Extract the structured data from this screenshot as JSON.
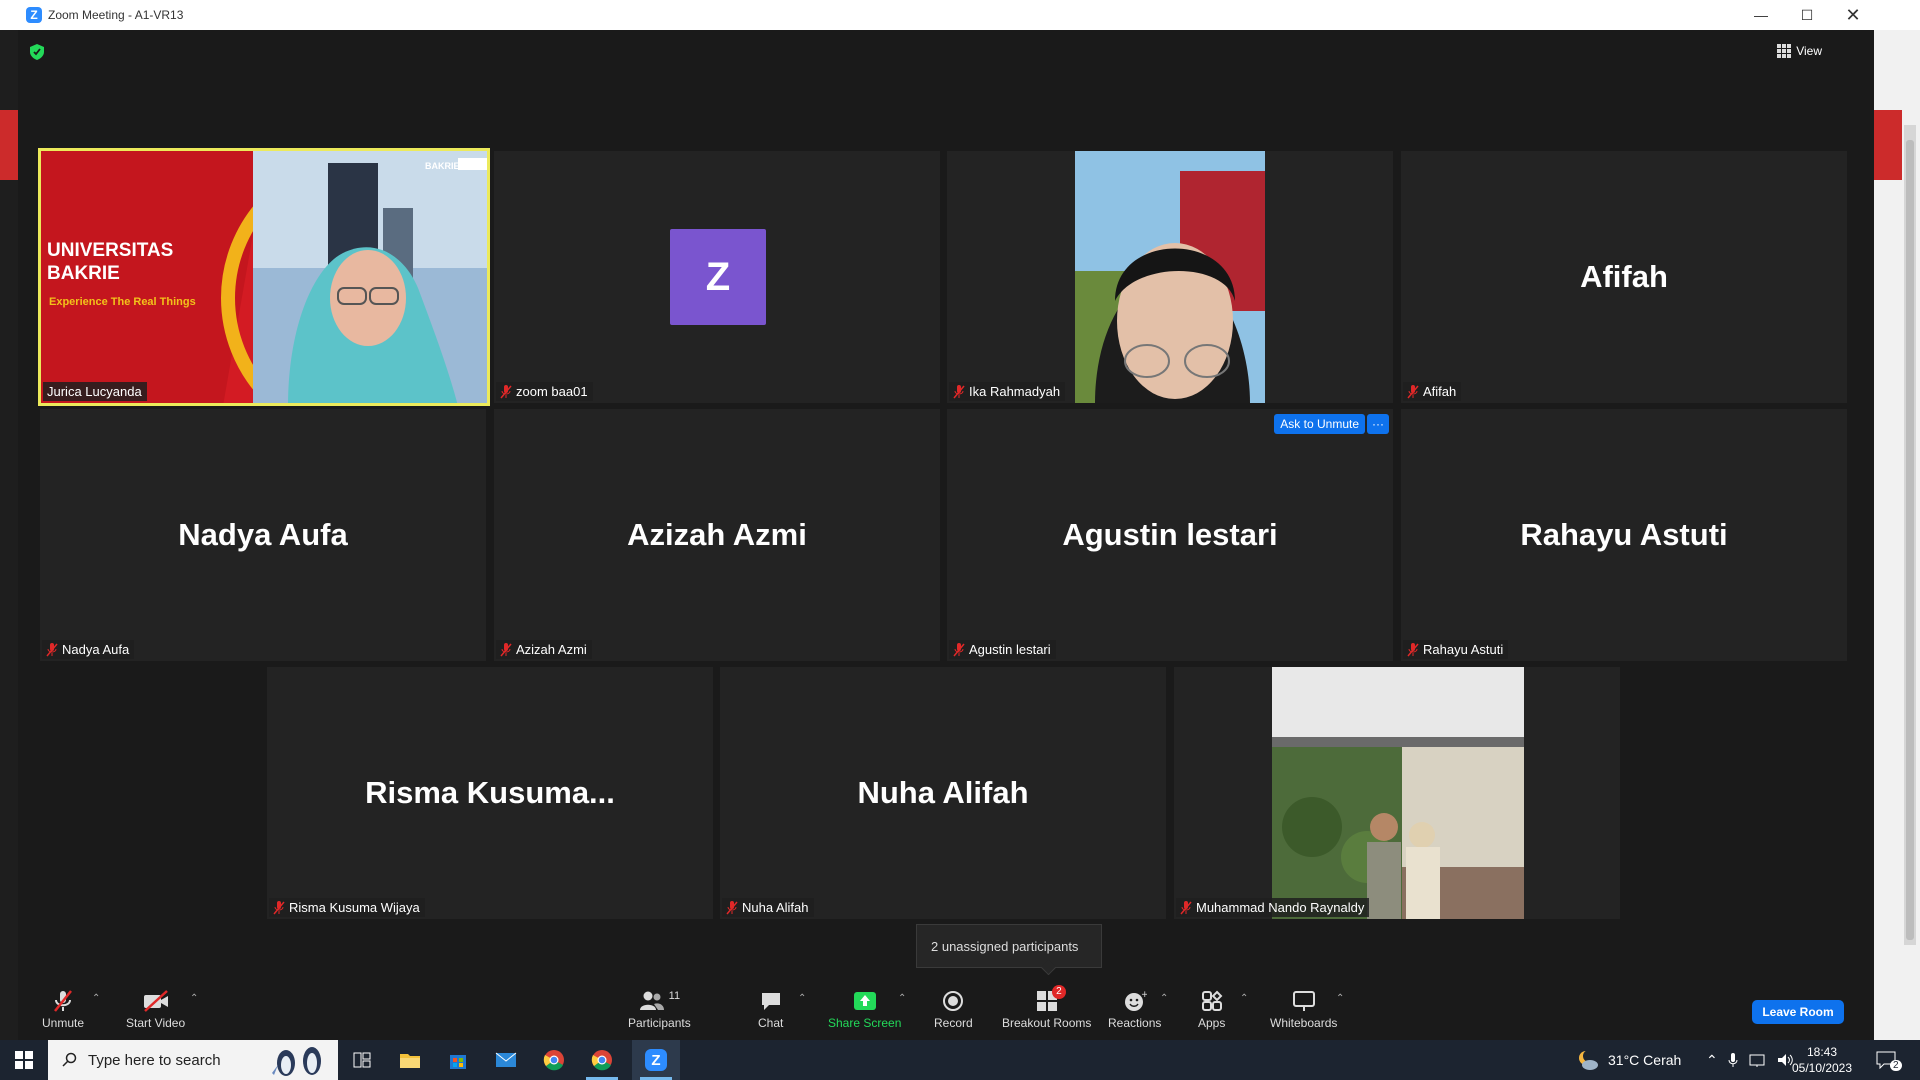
{
  "window": {
    "title": "Zoom Meeting - A1-VR13",
    "view_label": "View"
  },
  "colors": {
    "accent": "#0e72ed",
    "active_speaker": "#ecea5b",
    "avatar_purple": "#7a55cf",
    "mic_off_red": "#e02828",
    "share_green": "#23d959"
  },
  "tiles": [
    {
      "name": "Jurica Lucyanda",
      "big_name": "",
      "video": true,
      "active": true,
      "video_text": {
        "brand": "UNIVERSITAS BAKRIE",
        "line1": "UNIVERSITAS",
        "line2": "BAKRIE",
        "tagline": "Experience The Real Things",
        "logo": "BAKRIE"
      }
    },
    {
      "name": "zoom baa01",
      "big_name": "",
      "avatar_letter": "Z"
    },
    {
      "name": "Ika Rahmadyah",
      "big_name": "",
      "video": true
    },
    {
      "name": "Afifah",
      "big_name": "Afifah"
    },
    {
      "name": "Nadya Aufa",
      "big_name": "Nadya Aufa"
    },
    {
      "name": "Azizah Azmi",
      "big_name": "Azizah Azmi"
    },
    {
      "name": "Agustin lestari",
      "big_name": "Agustin lestari",
      "ask_unmute": "Ask to Unmute",
      "more": "···"
    },
    {
      "name": "Rahayu Astuti",
      "big_name": "Rahayu Astuti"
    },
    {
      "name": "Risma Kusuma Wijaya",
      "big_name": "Risma  Kusuma..."
    },
    {
      "name": "Nuha Alifah",
      "big_name": "Nuha Alifah"
    },
    {
      "name": "Muhammad Nando Raynaldy",
      "big_name": "",
      "video": true
    }
  ],
  "toast": "2 unassigned participants",
  "toolbar": {
    "unmute": "Unmute",
    "start_video": "Start Video",
    "participants": "Participants",
    "participants_count": "11",
    "chat": "Chat",
    "share_screen": "Share Screen",
    "record": "Record",
    "breakout_rooms": "Breakout Rooms",
    "breakout_badge": "2",
    "reactions": "Reactions",
    "apps": "Apps",
    "whiteboards": "Whiteboards",
    "leave": "Leave Room"
  },
  "taskbar": {
    "search_placeholder": "Type here to search",
    "weather": "31°C  Cerah",
    "time": "18:43",
    "date": "05/10/2023",
    "notifications": "2",
    "apps": [
      "task-view-icon",
      "file-explorer-icon",
      "store-icon",
      "mail-icon",
      "chrome-icon",
      "chrome-profile-icon",
      "zoom-icon"
    ]
  }
}
